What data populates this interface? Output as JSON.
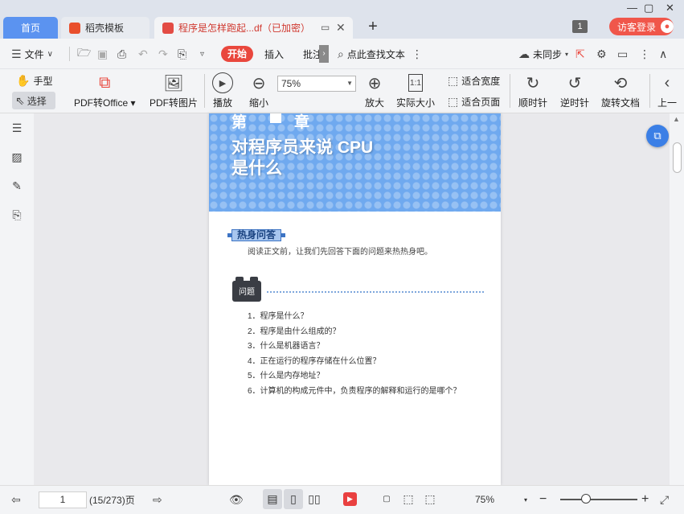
{
  "tabs": {
    "home": "首页",
    "template": "稻壳模板",
    "doc": "程序是怎样跑起...df（已加密）",
    "add": "+"
  },
  "window": {
    "badge": "1",
    "login": "访客登录"
  },
  "menu": {
    "file": "文件",
    "start": "开始",
    "insert": "插入",
    "annotate": "批注",
    "search_text": "点此查找文本",
    "sync": "未同步"
  },
  "ribbon": {
    "hand": "手型",
    "select": "选择",
    "pdf_to_office": "PDF转Office",
    "pdf_to_image": "PDF转图片",
    "play": "播放",
    "zoom_out": "缩小",
    "zoom_value": "75%",
    "zoom_in": "放大",
    "actual_size": "实际大小",
    "fit_width": "适合宽度",
    "fit_page": "适合页面",
    "clockwise": "顺时针",
    "counter_clockwise": "逆时针",
    "rotate_doc": "旋转文档",
    "prev": "上一"
  },
  "page": {
    "chapter_prefix": "第",
    "chapter_suffix": "章",
    "title_line1": "对程序员来说 CPU",
    "title_line2": "是什么",
    "warmup": "热身问答",
    "intro": "阅读正文前，让我们先回答下面的问题来热热身吧。",
    "q_badge": "问题",
    "questions": [
      "1．程序是什么？",
      "2．程序是由什么组成的？",
      "3．什么是机器语言？",
      "4．正在运行的程序存储在什么位置？",
      "5．什么是内存地址？",
      "6．计算机的构成元件中，负责程序的解释和运行的是哪个？"
    ]
  },
  "status": {
    "page_input": "1",
    "page_info": "(15/273)页",
    "zoom": "75%"
  },
  "colors": {
    "accent_blue": "#5b93f0",
    "start_red": "#e9473d",
    "banner_blue": "#6fa9ef"
  }
}
